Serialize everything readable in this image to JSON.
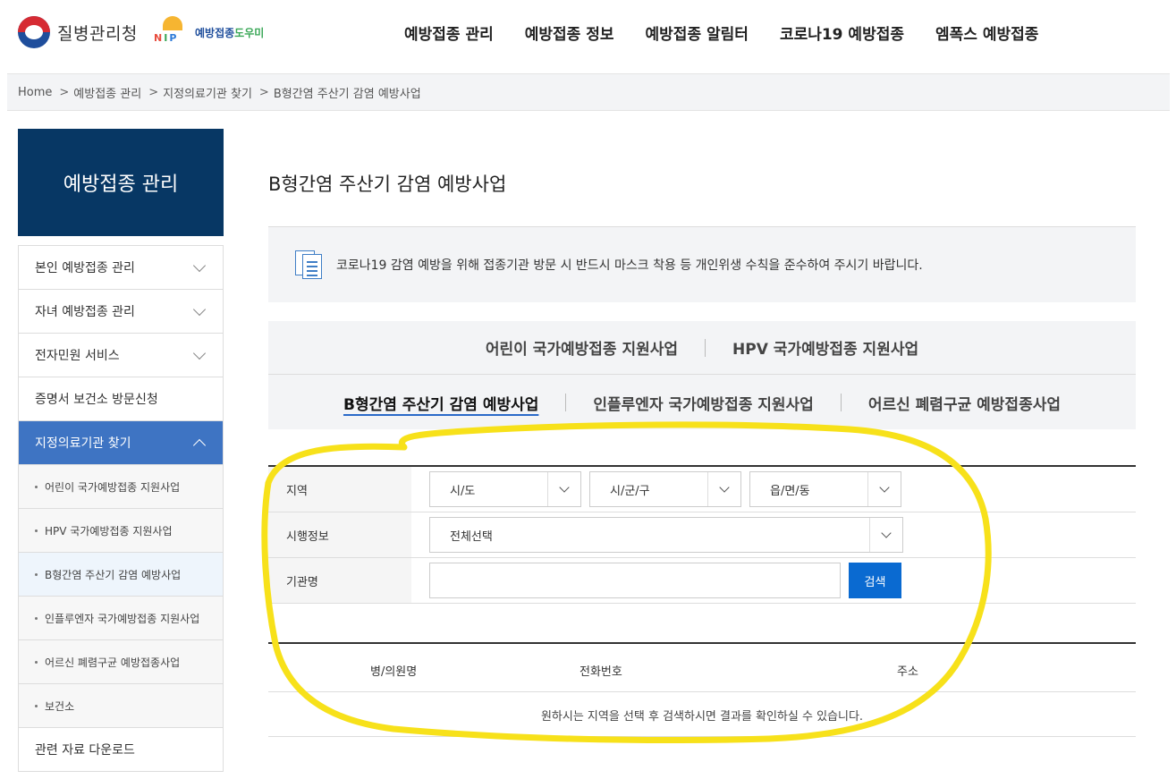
{
  "header": {
    "agency_name": "질병관리청",
    "nip_letters": [
      "N",
      "I",
      "P"
    ],
    "nip_text": "예방접종",
    "nip_text_accent": "도우미",
    "nav": [
      "예방접종 관리",
      "예방접종 정보",
      "예방접종 알림터",
      "코로나19 예방접종",
      "엠폭스 예방접종"
    ]
  },
  "breadcrumb": [
    "Home",
    "예방접종 관리",
    "지정의료기관 찾기",
    "B형간염 주산기 감염 예방사업"
  ],
  "sidebar": {
    "title": "예방접종 관리",
    "items": [
      {
        "label": "본인 예방접종 관리"
      },
      {
        "label": "자녀 예방접종 관리"
      },
      {
        "label": "전자민원 서비스"
      },
      {
        "label": "증명서 보건소 방문신청"
      },
      {
        "label": "지정의료기관 찾기"
      }
    ],
    "subitems": [
      "어린이 국가예방접종 지원사업",
      "HPV 국가예방접종 지원사업",
      "B형간염 주산기 감염 예방사업",
      "인플루엔자 국가예방접종 지원사업",
      "어르신 폐렴구균 예방접종사업",
      "보건소"
    ],
    "last_item": "관련 자료 다운로드"
  },
  "main": {
    "title": "B형간염 주산기 감염 예방사업",
    "notice": "코로나19 감염 예방을 위해 접종기관 방문 시 반드시 마스크 착용 등 개인위생 수칙을 준수하여 주시기 바랍니다.",
    "tabs_row1": [
      "어린이 국가예방접종 지원사업",
      "HPV 국가예방접종 지원사업"
    ],
    "tabs_row2": [
      "B형간염 주산기 감염 예방사업",
      "인플루엔자 국가예방접종 지원사업",
      "어르신 폐렴구균 예방접종사업"
    ],
    "selected_tab": "B형간염 주산기 감염 예방사업"
  },
  "search": {
    "region_label": "지역",
    "sido": "시/도",
    "sigungu": "시/군/구",
    "emd": "읍/면/동",
    "info_label": "시행정보",
    "info_value": "전체선택",
    "name_label": "기관명",
    "name_value": "",
    "button": "검색"
  },
  "results": {
    "columns": [
      "병/의원명",
      "전화번호",
      "주소"
    ],
    "empty_message": "원하시는 지역을 선택 후 검색하시면 결과를 확인하실 수 있습니다."
  },
  "colors": {
    "sidebar_title_bg": "#073764",
    "active_menu_bg": "#3e74c3",
    "search_button_bg": "#0a6ad1",
    "highlight_annotation": "#f7e11a"
  },
  "icons": [
    "emblem-icon",
    "nip-logo-icon",
    "chevron-down-icon",
    "chevron-up-icon",
    "document-icon"
  ]
}
